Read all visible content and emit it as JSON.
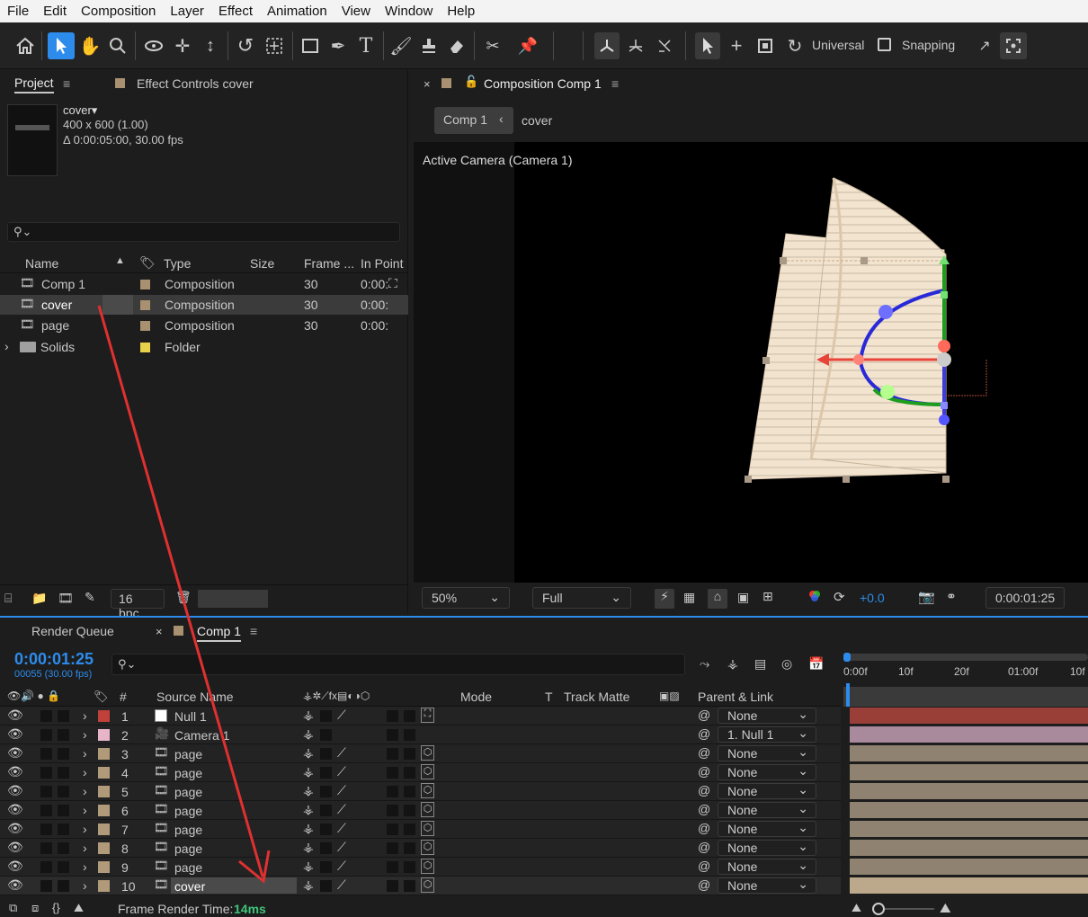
{
  "menu": [
    "File",
    "Edit",
    "Composition",
    "Layer",
    "Effect",
    "Animation",
    "View",
    "Window",
    "Help"
  ],
  "toolbar": {
    "axis_mode": "Universal",
    "snapping": "Snapping"
  },
  "project_panel": {
    "tab": "Project",
    "effect_controls_tab": "Effect Controls cover",
    "preview": {
      "name": "cover",
      "dims": "400 x 600 (1.00)",
      "duration": "Δ 0:00:05:00, 30.00 fps"
    },
    "search_placeholder": "",
    "columns": [
      "Name",
      "Type",
      "Size",
      "Frame ...",
      "In Point"
    ],
    "items": [
      {
        "name": "Comp 1",
        "type": "Composition",
        "frame": "30",
        "in": "0:00:",
        "color": "#a89070"
      },
      {
        "name": "cover",
        "type": "Composition",
        "frame": "30",
        "in": "0:00:",
        "color": "#a89070"
      },
      {
        "name": "page",
        "type": "Composition",
        "frame": "30",
        "in": "0:00:",
        "color": "#a89070"
      },
      {
        "name": "Solids",
        "type": "Folder",
        "frame": "",
        "in": "",
        "color": "#e8d14a"
      }
    ],
    "bpc": "16 bpc"
  },
  "comp_panel": {
    "tab": "Composition Comp 1",
    "breadcrumbs": [
      "Comp 1",
      "cover"
    ],
    "view_label": "Active Camera (Camera 1)",
    "zoom": "50%",
    "resolution": "Full",
    "exposure": "+0.0",
    "timecode": "0:00:01:25"
  },
  "timeline": {
    "render_queue_tab": "Render Queue",
    "comp_tab": "Comp 1",
    "current_time": "0:00:01:25",
    "frame_info": "00055 (30.00 fps)",
    "headers": {
      "num": "#",
      "source": "Source Name",
      "mode": "Mode",
      "t": "T",
      "track": "Track Matte",
      "parent": "Parent & Link"
    },
    "ruler": [
      "0:00f",
      "10f",
      "20f",
      "01:00f",
      "10f"
    ],
    "layers": [
      {
        "num": "1",
        "name": "Null 1",
        "parent": "None",
        "color": "#c0403a"
      },
      {
        "num": "2",
        "name": "Camera 1",
        "parent": "1. Null 1",
        "color": "#e8b4c8"
      },
      {
        "num": "3",
        "name": "page",
        "parent": "None",
        "color": "#b09a7a"
      },
      {
        "num": "4",
        "name": "page",
        "parent": "None",
        "color": "#b09a7a"
      },
      {
        "num": "5",
        "name": "page",
        "parent": "None",
        "color": "#b09a7a"
      },
      {
        "num": "6",
        "name": "page",
        "parent": "None",
        "color": "#b09a7a"
      },
      {
        "num": "7",
        "name": "page",
        "parent": "None",
        "color": "#b09a7a"
      },
      {
        "num": "8",
        "name": "page",
        "parent": "None",
        "color": "#b09a7a"
      },
      {
        "num": "9",
        "name": "page",
        "parent": "None",
        "color": "#b09a7a"
      },
      {
        "num": "10",
        "name": "cover",
        "parent": "None",
        "color": "#b09a7a"
      }
    ],
    "render_time_label": "Frame Render Time:",
    "render_time_value": "14ms"
  },
  "colors": {
    "accent": "#2d8ceb",
    "arrow": "#e03030",
    "green_time": "#3fc47a"
  }
}
